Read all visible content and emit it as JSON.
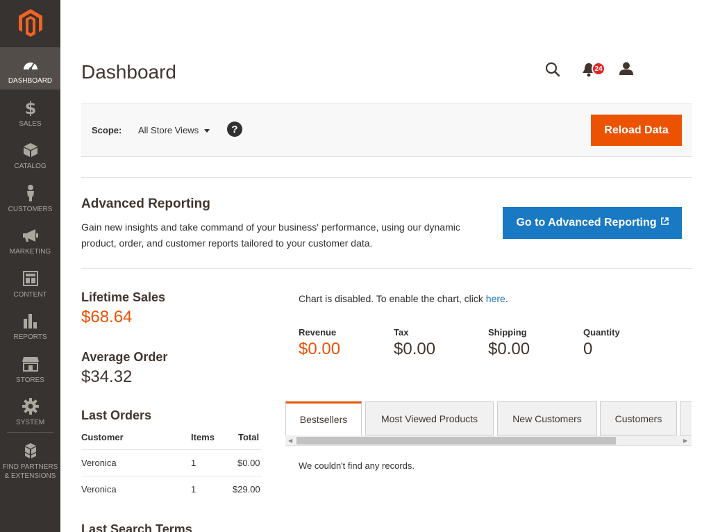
{
  "sidebar": {
    "items": [
      {
        "label": "DASHBOARD",
        "icon": "dashboard-icon"
      },
      {
        "label": "SALES",
        "icon": "dollar-icon"
      },
      {
        "label": "CATALOG",
        "icon": "box-icon"
      },
      {
        "label": "CUSTOMERS",
        "icon": "person-icon"
      },
      {
        "label": "MARKETING",
        "icon": "megaphone-icon"
      },
      {
        "label": "CONTENT",
        "icon": "layout-icon"
      },
      {
        "label": "REPORTS",
        "icon": "bar-chart-icon"
      },
      {
        "label": "STORES",
        "icon": "storefront-icon"
      },
      {
        "label": "SYSTEM",
        "icon": "gear-icon"
      },
      {
        "label": "FIND PARTNERS & EXTENSIONS",
        "icon": "cubes-icon"
      }
    ],
    "active_color": "#524d49",
    "background": "#373330"
  },
  "header": {
    "title": "Dashboard",
    "notifications_count": "24"
  },
  "scope": {
    "label": "Scope:",
    "value": "All Store Views",
    "help": "?",
    "reload_label": "Reload Data"
  },
  "advanced": {
    "title": "Advanced Reporting",
    "text": "Gain new insights and take command of your business' performance, using our dynamic product, order, and customer reports tailored to your customer data.",
    "button_label": "Go to Advanced Reporting"
  },
  "stats": {
    "lifetime_label": "Lifetime Sales",
    "lifetime_value": "$68.64",
    "average_label": "Average Order",
    "average_value": "$34.32"
  },
  "orders": {
    "title": "Last Orders",
    "columns": [
      "Customer",
      "Items",
      "Total"
    ],
    "rows": [
      {
        "customer": "Veronica",
        "items": "1",
        "total": "$0.00"
      },
      {
        "customer": "Veronica",
        "items": "1",
        "total": "$29.00"
      }
    ]
  },
  "search_terms_title": "Last Search Terms",
  "chart": {
    "note_prefix": "Chart is disabled. To enable the chart, click ",
    "note_link": "here",
    "note_suffix": "."
  },
  "totals": [
    {
      "label": "Revenue",
      "value": "$0.00"
    },
    {
      "label": "Tax",
      "value": "$0.00"
    },
    {
      "label": "Shipping",
      "value": "$0.00"
    },
    {
      "label": "Quantity",
      "value": "0"
    }
  ],
  "tabs": [
    {
      "label": "Bestsellers"
    },
    {
      "label": "Most Viewed Products"
    },
    {
      "label": "New Customers"
    },
    {
      "label": "Customers"
    }
  ],
  "no_records": "We couldn't find any records.",
  "colors": {
    "accent": "#eb5202",
    "link": "#1979c3"
  }
}
